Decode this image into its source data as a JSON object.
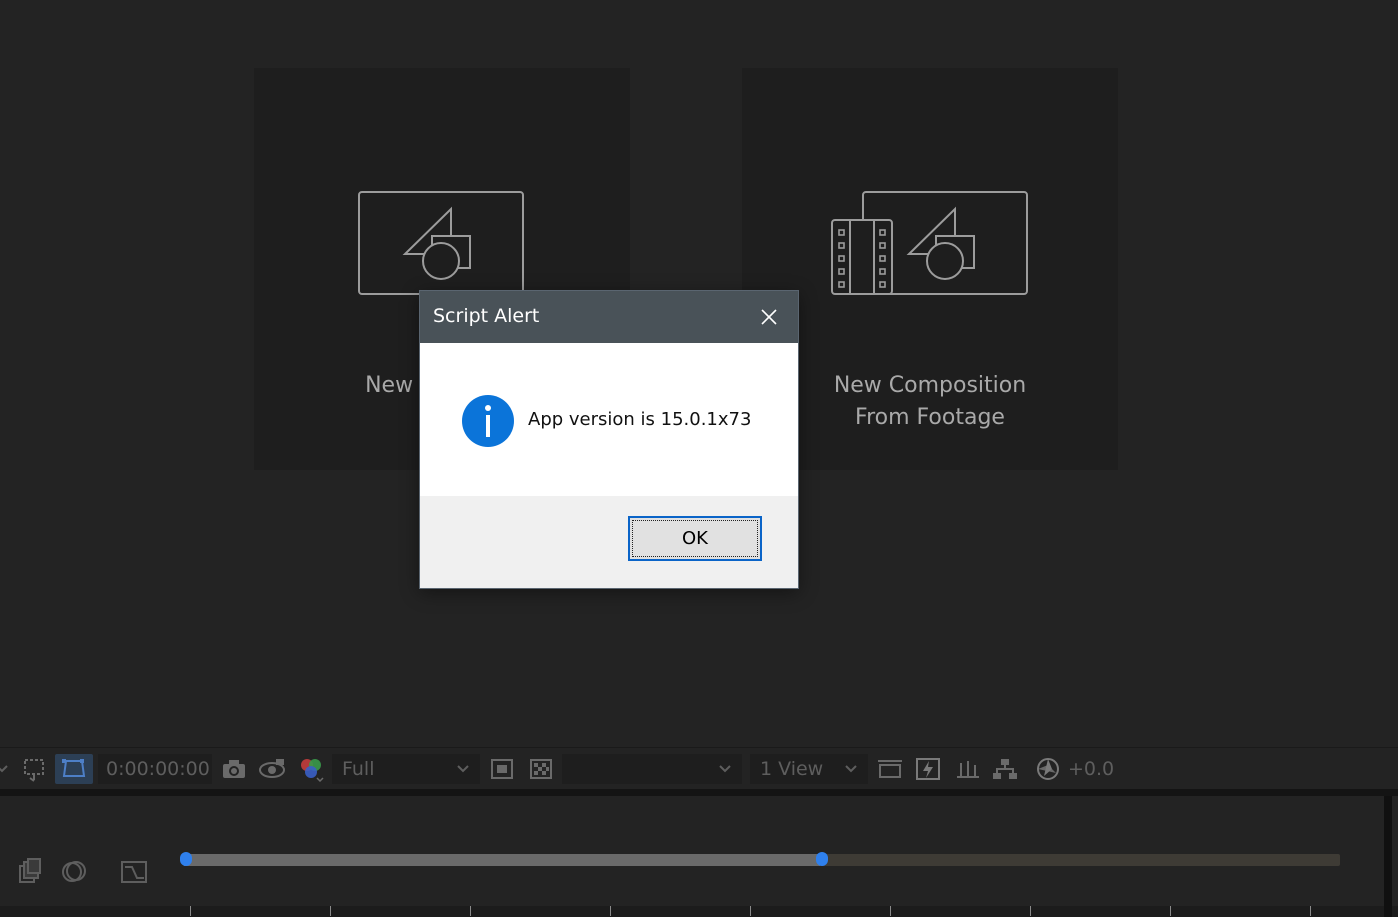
{
  "cards": {
    "left_label": "New Co",
    "right_label_line1": "New Composition",
    "right_label_line2": "From Footage"
  },
  "toolbar": {
    "timecode": "0:00:00:00",
    "resolution": "Full",
    "channel": "",
    "views": "1 View",
    "exposure": "+0.0"
  },
  "dialog": {
    "title": "Script Alert",
    "message": "App version is 15.0.1x73",
    "ok_label": "OK",
    "icon": "info-icon"
  },
  "colors": {
    "accent": "#2f80ed",
    "dialog_title_bar": "#495258",
    "info_blue": "#0b74d9"
  }
}
